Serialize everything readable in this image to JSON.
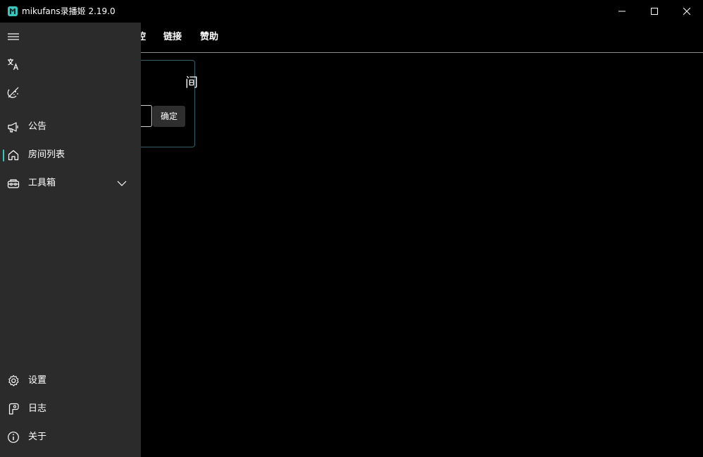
{
  "titlebar": {
    "app_icon": "app-logo-icon",
    "title": "mikufans录播姬 2.19.0",
    "buttons": [
      "minimize-icon",
      "maximize-icon",
      "close-icon"
    ]
  },
  "topnav": {
    "items": [
      "控",
      "链接",
      "赞助"
    ]
  },
  "card": {
    "title": "间",
    "input_value": "",
    "confirm_label": "确定"
  },
  "pane": {
    "menu_icon": "hamburger-menu-icon",
    "top_items": [
      {
        "icon": "translate-icon",
        "label": ""
      },
      {
        "icon": "theme-toggle-icon",
        "label": ""
      },
      {
        "icon": "megaphone-icon",
        "label": "公告"
      },
      {
        "icon": "home-icon",
        "label": "房间列表",
        "selected": true
      },
      {
        "icon": "toolbox-icon",
        "label": "工具箱",
        "expandable": true
      }
    ],
    "bottom_items": [
      {
        "icon": "gear-icon",
        "label": "设置"
      },
      {
        "icon": "log-icon",
        "label": "日志"
      },
      {
        "icon": "info-icon",
        "label": "关于"
      }
    ]
  },
  "colors": {
    "background": "#000000",
    "pane": "#2b2b2b",
    "accent": "#39c5bb",
    "card_border": "#3b5f66",
    "button": "#2e2e2e"
  }
}
